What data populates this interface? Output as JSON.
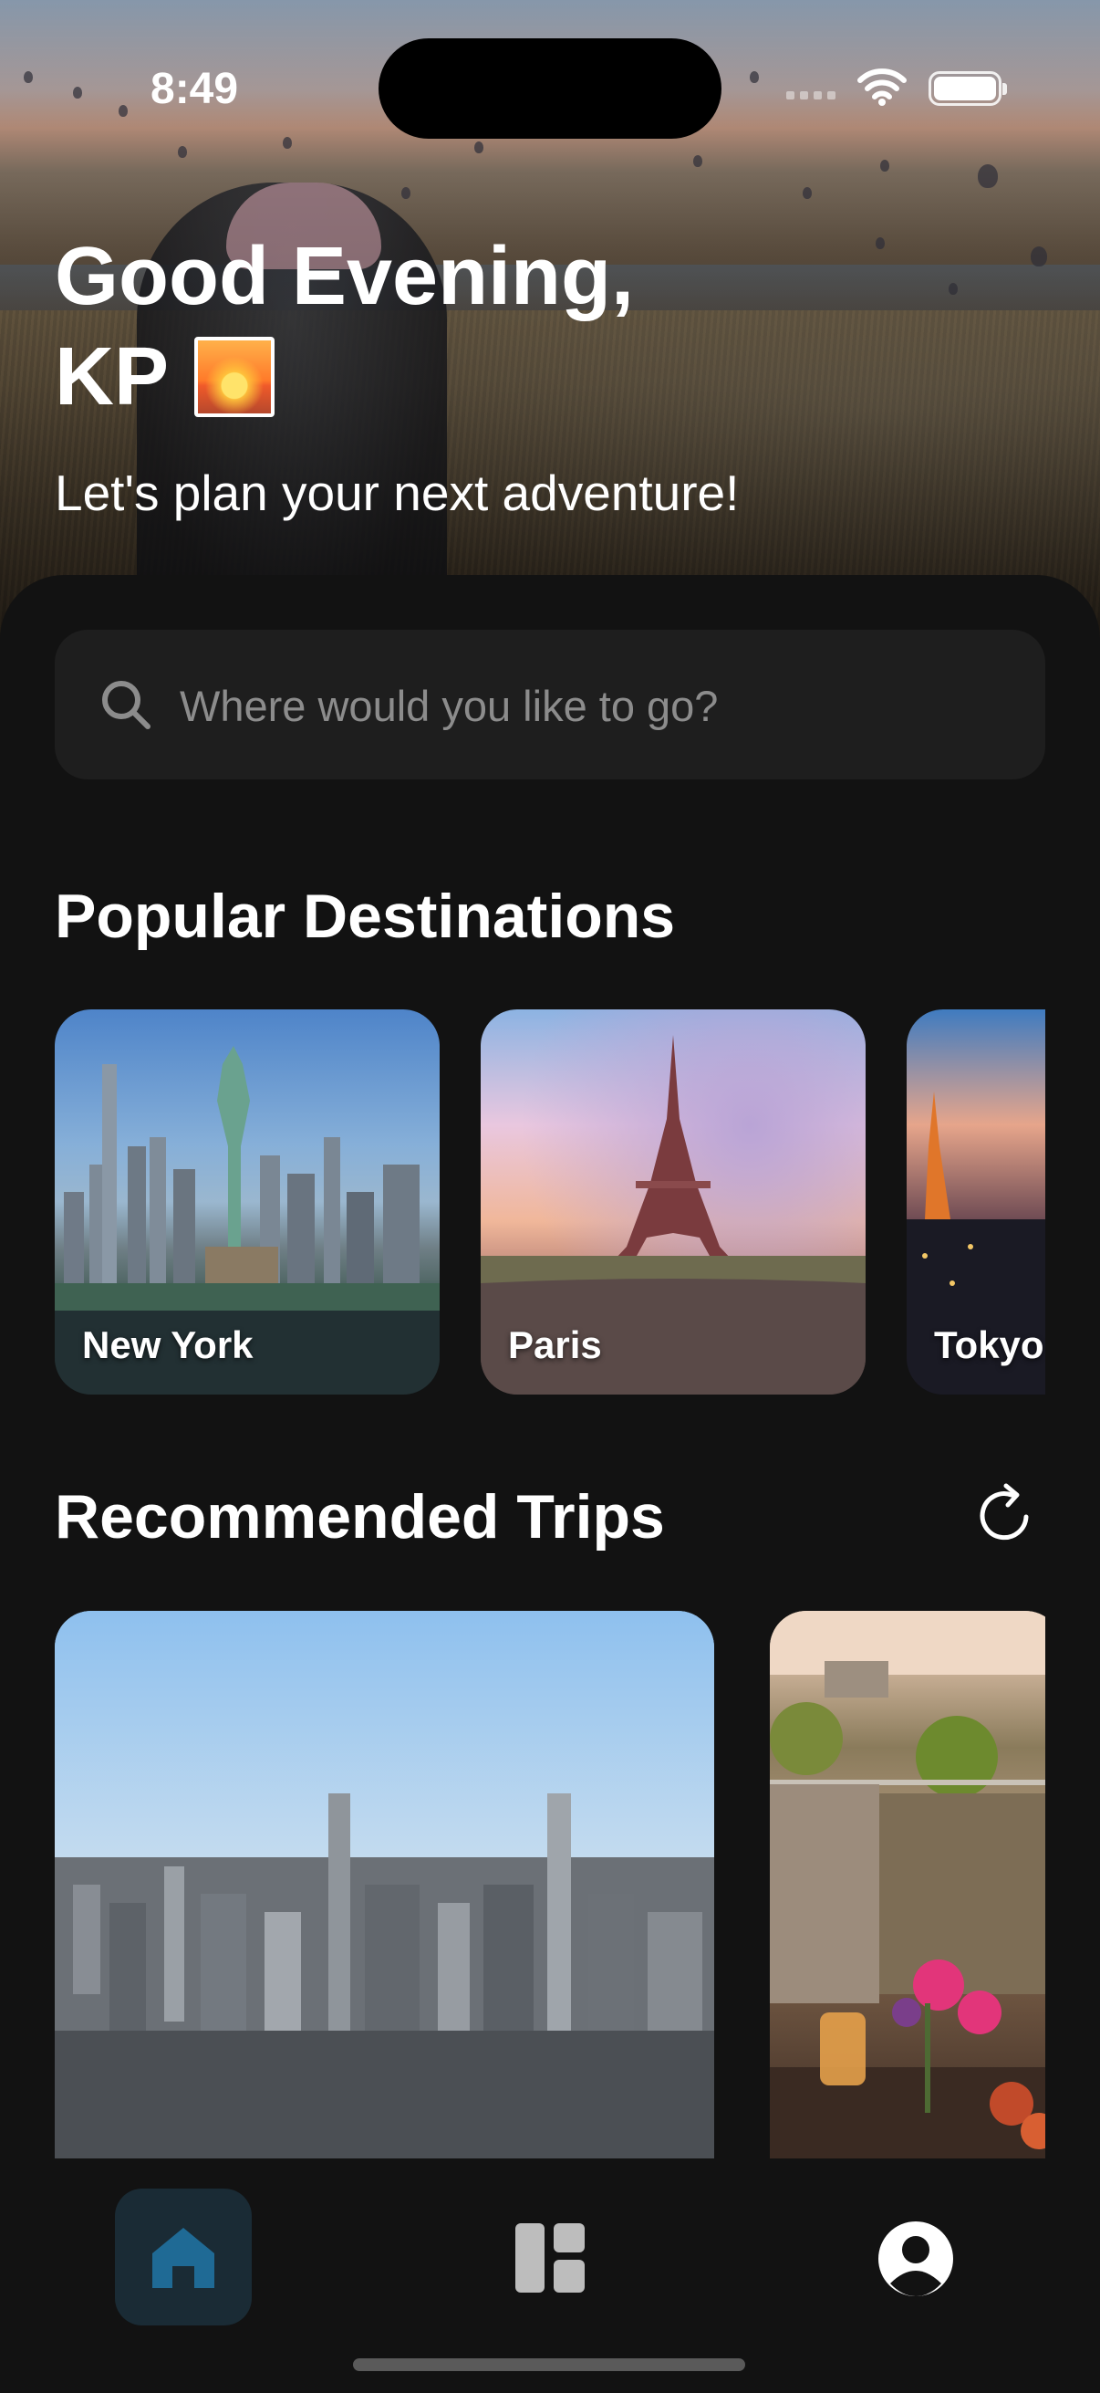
{
  "status_bar": {
    "time": "8:49"
  },
  "hero": {
    "greeting_line1": "Good Evening,",
    "greeting_name": "KP",
    "greeting_emoji": "sunset-emoji",
    "subtitle": "Let's plan your next adventure!"
  },
  "search": {
    "placeholder": "Where would you like to go?",
    "icon": "search-icon"
  },
  "popular": {
    "title": "Popular Destinations",
    "destinations": [
      {
        "name": "New York"
      },
      {
        "name": "Paris"
      },
      {
        "name": "Tokyo"
      }
    ]
  },
  "recommended": {
    "title": "Recommended Trips",
    "refresh_icon": "refresh-icon"
  },
  "tab_bar": {
    "tabs": [
      {
        "icon": "home-icon",
        "active": true
      },
      {
        "icon": "dashboard-icon",
        "active": false
      },
      {
        "icon": "profile-icon",
        "active": false
      }
    ]
  },
  "colors": {
    "background": "#121212",
    "search_field": "#1e1e1e",
    "active_tab_bg": "#1a2b35",
    "active_tab_icon": "#1f6a95",
    "inactive_icon": "#bdbdbd"
  }
}
